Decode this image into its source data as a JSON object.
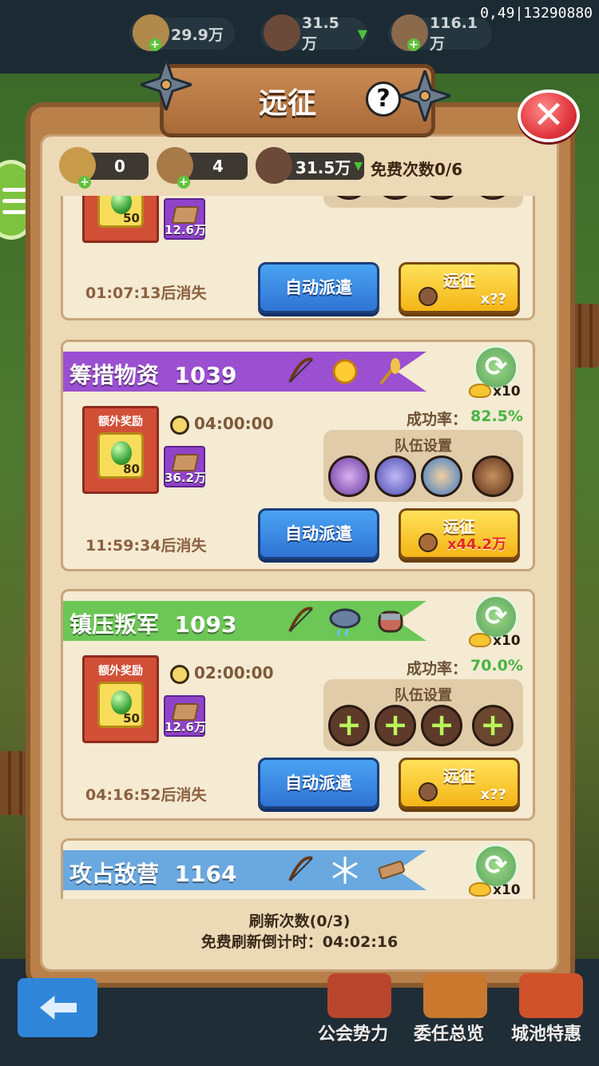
{
  "debug_id": "0,49|13290880",
  "top_resources": [
    {
      "icon": "wheat-icon",
      "value": "29.9万"
    },
    {
      "icon": "warrior-icon",
      "value": "31.5万"
    },
    {
      "icon": "wood-icon",
      "value": "116.1万"
    }
  ],
  "title": "远征",
  "help": "?",
  "close": "✕",
  "header": {
    "items": [
      {
        "icon": "scroll-ticket-icon",
        "value": "0"
      },
      {
        "icon": "wood-bundle-icon",
        "value": "4"
      },
      {
        "icon": "warrior-icon",
        "value": "31.5万"
      }
    ],
    "free_count": "免费次数0/6"
  },
  "cards": [
    {
      "reward_gem": "50",
      "reward_wood": "12.6万",
      "expire": "01:07:13后消失",
      "auto_label": "自动派遣",
      "go_label": "远征",
      "go_cost": "x??"
    },
    {
      "title": "筹措物资",
      "power": "1039",
      "color": "#9b4fd1",
      "refresh_cost": "x10",
      "extra_label": "额外奖励",
      "time": "04:00:00",
      "rate_label": "成功率：",
      "rate": "82.5%",
      "team_label": "队伍设置",
      "reward_gem": "80",
      "reward_wood": "36.2万",
      "expire": "11:59:34后消失",
      "auto_label": "自动派遣",
      "go_label": "远征",
      "go_cost": "x44.2万"
    },
    {
      "title": "镇压叛军",
      "power": "1093",
      "color": "#6cc756",
      "refresh_cost": "x10",
      "extra_label": "额外奖励",
      "time": "02:00:00",
      "rate_label": "成功率：",
      "rate": "70.0%",
      "team_label": "队伍设置",
      "reward_gem": "50",
      "reward_wood": "12.6万",
      "expire": "04:16:52后消失",
      "auto_label": "自动派遣",
      "go_label": "远征",
      "go_cost": "x??"
    },
    {
      "title": "攻占敌营",
      "power": "1164",
      "color": "#6aa8e0",
      "refresh_cost": "x10"
    }
  ],
  "slot_plus": "+",
  "refresh_glyph": "⟳",
  "footer": {
    "refresh_count": "刷新次数(0/3)",
    "countdown": "免费刷新倒计时：04:02:16"
  },
  "bottom_nav": [
    "公会势力",
    "委任总览",
    "城池特惠"
  ]
}
